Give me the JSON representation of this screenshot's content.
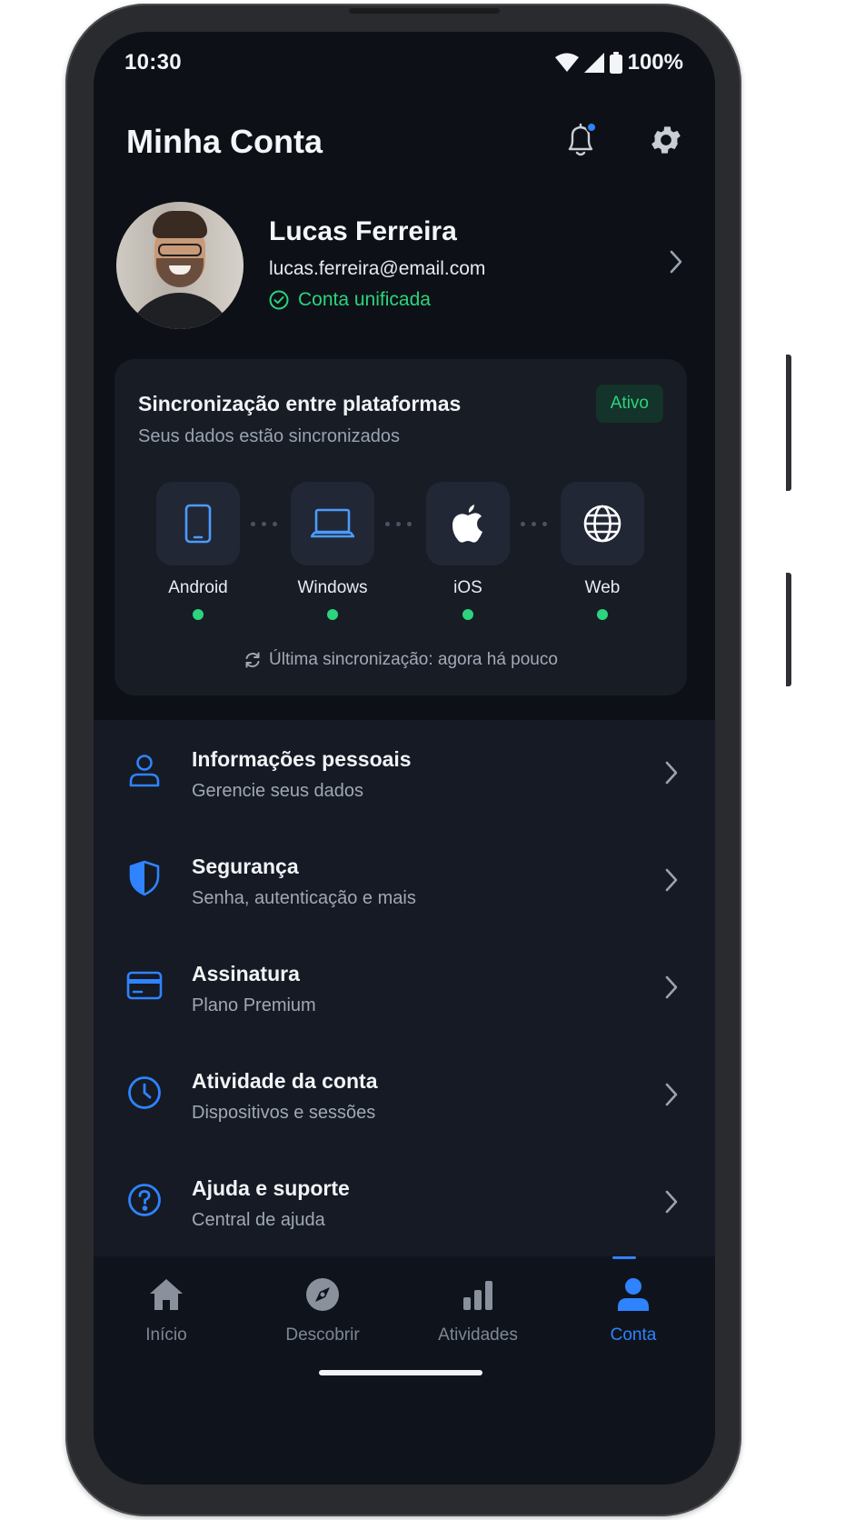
{
  "status_bar": {
    "time": "10:30",
    "battery": "100%"
  },
  "header": {
    "title": "Minha Conta",
    "has_notification": true
  },
  "profile": {
    "name": "Lucas Ferreira",
    "email": "lucas.ferreira@email.com",
    "status": "Conta unificada",
    "status_color": "#2bd47d"
  },
  "sync": {
    "title": "Sincronização entre plataformas",
    "subtitle": "Seus dados estão sincronizados",
    "badge": "Ativo",
    "devices": [
      {
        "label": "Android",
        "icon": "smartphone-icon",
        "synced": true
      },
      {
        "label": "Windows",
        "icon": "laptop-icon",
        "synced": true
      },
      {
        "label": "iOS",
        "icon": "apple-icon",
        "synced": true
      },
      {
        "label": "Web",
        "icon": "globe-icon",
        "synced": true
      }
    ],
    "last_sync": "Última sincronização: agora há pouco"
  },
  "menu": {
    "items": [
      {
        "title": "Informações pessoais",
        "subtitle": "Gerencie seus dados",
        "icon": "user-icon"
      },
      {
        "title": "Segurança",
        "subtitle": "Senha, autenticação e mais",
        "icon": "shield-icon"
      },
      {
        "title": "Assinatura",
        "subtitle": "Plano Premium",
        "icon": "credit-card-icon"
      },
      {
        "title": "Atividade da conta",
        "subtitle": "Dispositivos e sessões",
        "icon": "clock-icon"
      },
      {
        "title": "Ajuda e suporte",
        "subtitle": "Central de ajuda",
        "icon": "help-circle-icon"
      }
    ]
  },
  "bottom_nav": {
    "items": [
      {
        "label": "Início",
        "icon": "home-icon",
        "active": false
      },
      {
        "label": "Descobrir",
        "icon": "compass-icon",
        "active": false
      },
      {
        "label": "Atividades",
        "icon": "bar-chart-icon",
        "active": false
      },
      {
        "label": "Conta",
        "icon": "person-icon",
        "active": true
      }
    ]
  },
  "colors": {
    "accent": "#2f83ff",
    "success": "#2bd47d",
    "background": "#0d1117",
    "card": "#171c25"
  }
}
